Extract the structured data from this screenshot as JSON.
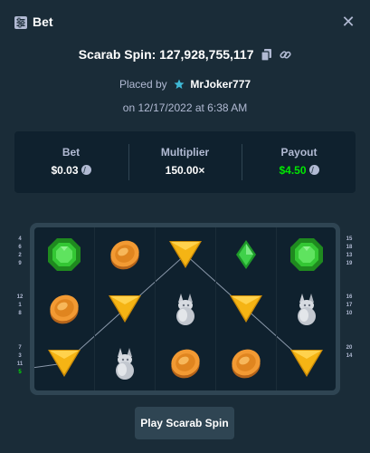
{
  "modal": {
    "title": "Bet",
    "close_glyph": "✕"
  },
  "spin": {
    "label": "Scarab Spin: 127,928,755,117"
  },
  "placed": {
    "prefix": "Placed by",
    "user": "MrJoker777",
    "date": "on 12/17/2022 at 6:38 AM"
  },
  "stats": {
    "bet_label": "Bet",
    "bet_value": "$0.03",
    "multiplier_label": "Multiplier",
    "multiplier_value": "150.00×",
    "payout_label": "Payout",
    "payout_value": "$4.50"
  },
  "board": {
    "rows": [
      [
        "emerald",
        "coin",
        "triangle",
        "diamond",
        "emerald"
      ],
      [
        "coin",
        "triangle",
        "scarab",
        "triangle",
        "scarab"
      ],
      [
        "triangle",
        "scarab",
        "coin",
        "coin",
        "triangle"
      ]
    ],
    "winning_line": [
      2,
      1,
      0,
      1,
      2
    ]
  },
  "left_lines": {
    "row1": [
      "4",
      "6",
      "2",
      "9"
    ],
    "row2": [
      "12",
      "1",
      "8"
    ],
    "row3": [
      "7",
      "3",
      "11",
      "5"
    ],
    "win_number": "5"
  },
  "right_lines": {
    "row1": [
      "15",
      "18",
      "13",
      "19"
    ],
    "row2": [
      "16",
      "17",
      "10"
    ],
    "row3": [
      "20",
      "14"
    ]
  },
  "colors": {
    "background": "#1a2c38",
    "panel": "#0f212e",
    "border": "#2f4553",
    "win_green": "#00e701",
    "muted": "#b1bad3"
  },
  "icons": {
    "header": "sliders-icon",
    "copy": "copy-icon",
    "link": "link-icon",
    "vip": "vip-star-icon",
    "coin": "litecoin-icon"
  },
  "button": {
    "play_label": "Play Scarab Spin"
  }
}
